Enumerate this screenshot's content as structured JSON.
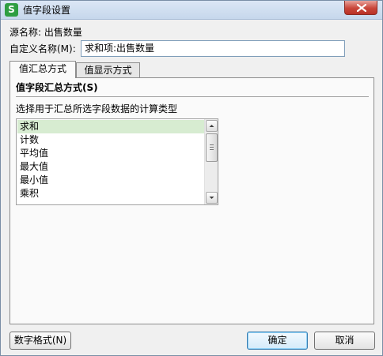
{
  "window": {
    "title": "值字段设置",
    "icon_letter": "S",
    "icon_color": "#2e9e42"
  },
  "source": {
    "label": "源名称:",
    "value": "出售数量"
  },
  "custom_name": {
    "label": "自定义名称(M):",
    "value": "求和项:出售数量"
  },
  "tabs": [
    {
      "label": "值汇总方式",
      "active": true
    },
    {
      "label": "值显示方式",
      "active": false
    }
  ],
  "summary": {
    "section_title": "值字段汇总方式(S)",
    "prompt": "选择用于汇总所选字段数据的计算类型",
    "items": [
      "求和",
      "计数",
      "平均值",
      "最大值",
      "最小值",
      "乘积"
    ],
    "selected_index": 0,
    "selected_color": "#d7ecd1"
  },
  "buttons": {
    "number_format": "数字格式(N)",
    "ok": "确定",
    "cancel": "取消"
  }
}
